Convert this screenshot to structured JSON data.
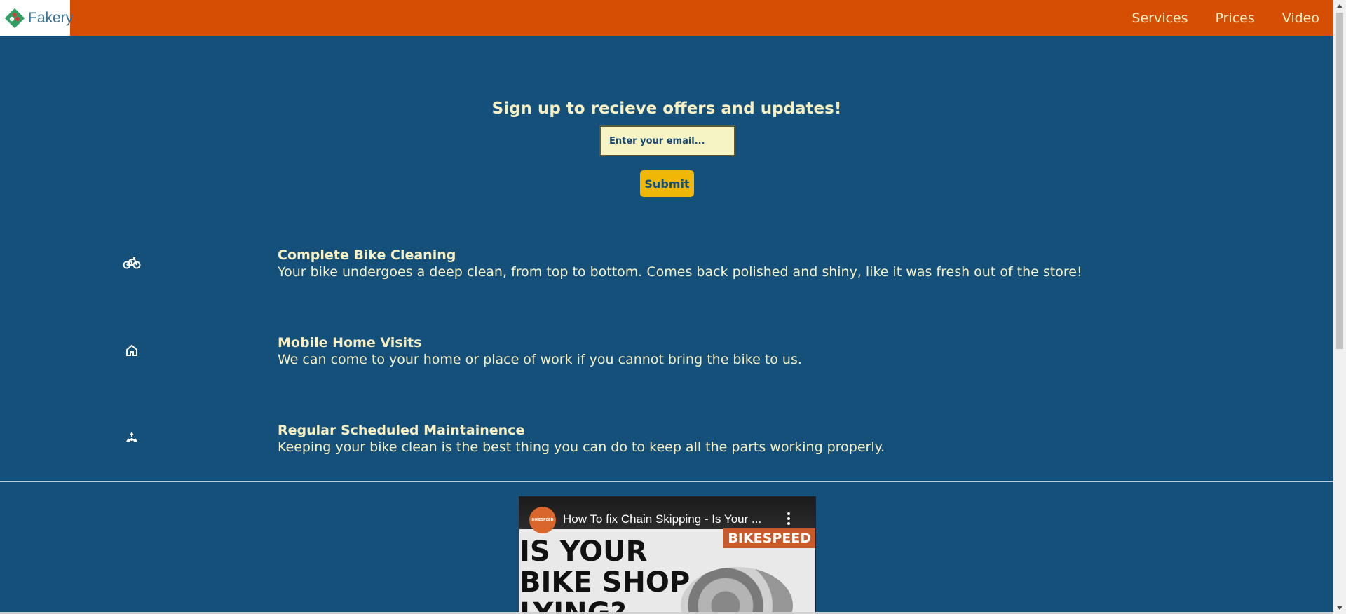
{
  "header": {
    "logo_text": "Fakery",
    "nav": [
      "Services",
      "Prices",
      "Video"
    ]
  },
  "signup": {
    "title": "Sign up to recieve offers and updates!",
    "email_placeholder": "Enter your email...",
    "submit_label": "Submit"
  },
  "features": [
    {
      "icon": "bicycle-icon",
      "title": "Complete Bike Cleaning",
      "description": "Your bike undergoes a deep clean, from top to bottom. Comes back polished and shiny, like it was fresh out of the store!"
    },
    {
      "icon": "home-icon",
      "title": "Mobile Home Visits",
      "description": "We can come to your home or place of work if you cannot bring the bike to us."
    },
    {
      "icon": "recycle-icon",
      "title": "Regular Scheduled Maintainence",
      "description": "Keeping your bike clean is the best thing you can do to keep all the parts working properly."
    }
  ],
  "video": {
    "channel_avatar_text": "BIKESPEED",
    "title": "How To fix Chain Skipping - Is Your ...",
    "badge": "BIKESPEED",
    "thumbnail_text": "IS YOUR\nBIKE SHOP\nLYING?"
  },
  "colors": {
    "background": "#14507a",
    "header": "#d64e03",
    "text": "#f6f0c4",
    "submit": "#f1b707",
    "input": "#f6f3c4"
  }
}
